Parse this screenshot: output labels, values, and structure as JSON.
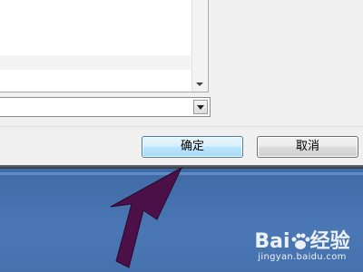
{
  "dialog": {
    "combo_value": "",
    "buttons": {
      "ok_label": "确定",
      "cancel_label": "取消"
    }
  },
  "watermark": {
    "brand_text": "Bai",
    "brand_suffix": "经验",
    "site": "jingyan.baidu.com"
  },
  "colors": {
    "ok_border": "#3c7fb1",
    "desktop": "#4a78b4",
    "cursor": "#4b1048"
  },
  "icons": [
    "scroll-down-arrow-icon",
    "dropdown-arrow-icon",
    "mouse-cursor-icon",
    "paw-logo-icon"
  ]
}
